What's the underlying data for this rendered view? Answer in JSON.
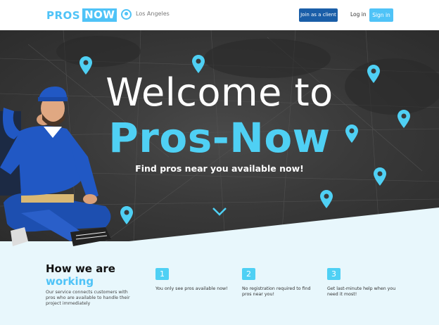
{
  "header": {
    "logo_part1": "PROS",
    "logo_part2": "NOW",
    "location": "Los Angeles",
    "join_label": "Join as a client",
    "login_label": "Log in",
    "signin_label": "Sign in"
  },
  "hero": {
    "title_line1": "Welcome to",
    "title_line2": "Pros-Now",
    "subtitle": "Find pros near you available now!"
  },
  "how": {
    "title_line1": "How we are",
    "title_line2": "working",
    "description": "Our service connects customers with pros who are available to handle their project immediately",
    "steps": [
      {
        "number": "1",
        "text": "You only see pros available now!"
      },
      {
        "number": "2",
        "text": "No registration required to find pros near you!"
      },
      {
        "number": "3",
        "text": "Get last-minute help when you need it most!"
      }
    ]
  },
  "colors": {
    "accent": "#4fc3f7",
    "brand_dark": "#1a5ea8",
    "hero_bg": "#3a3a3a",
    "light_bg": "#e8f7fc"
  },
  "icons": [
    "location-pin-icon",
    "map-pin-icon",
    "chevron-down-icon"
  ]
}
